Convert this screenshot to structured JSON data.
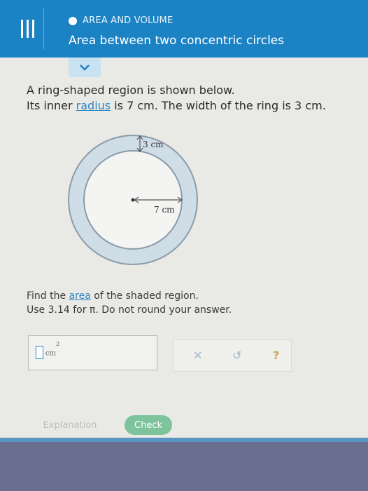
{
  "header": {
    "topic": "AREA AND VOLUME",
    "title": "Area between two concentric circles"
  },
  "prompt": {
    "line1": "A ring-shaped region is shown below.",
    "line2_pre": "Its inner ",
    "line2_link": "radius",
    "line2_post": " is 7 cm. The width of the ring is 3 cm."
  },
  "figure": {
    "outer_label": "3 cm",
    "inner_label": "7 cm",
    "ring_color": "#cfdde7",
    "stroke_color": "#8c9ba8"
  },
  "question": {
    "line1_pre": "Find the ",
    "line1_link": "area",
    "line1_post": " of the shaded region.",
    "line2": "Use 3.14 for π. Do not round your answer."
  },
  "answer": {
    "value": "",
    "unit": "cm",
    "unit_exp": "2"
  },
  "buttons": {
    "explanation": "Explanation",
    "check": "Check"
  },
  "icons": [
    "menu-icon",
    "collapse-chevron-icon",
    "clear-icon",
    "undo-icon",
    "help-icon"
  ]
}
